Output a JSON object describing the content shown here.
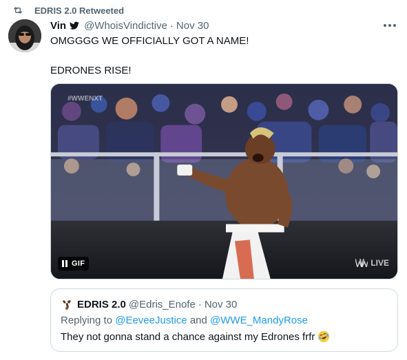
{
  "retweet": {
    "label": "EDRIS 2.0 Retweeted",
    "icon": "retweet-icon"
  },
  "tweet": {
    "author_name": "Vin",
    "author_handle": "@WhoisVindictive",
    "separator": "·",
    "date": "Nov 30",
    "verified_icon": "twitter-bird-icon",
    "lines": [
      "OMGGGG WE OFFICIALLY GOT A NAME!",
      "EDRONES RISE!"
    ],
    "media": {
      "badge_label": "GIF",
      "watermark_live": "LIVE",
      "watermark_tag": "#WWENXT"
    }
  },
  "quoted": {
    "author_name": "EDRIS 2.0",
    "author_handle": "@Edris_Enofe",
    "separator": "·",
    "date": "Nov 30",
    "replying_prefix": "Replying to ",
    "replying_to_1": "@EeveeJustice",
    "replying_and": " and ",
    "replying_to_2": "@WWE_MandyRose",
    "text": "They not gonna stand a chance against my Edrones frfr",
    "emoji_icon": "rolling-laughing-emoji-icon"
  },
  "colors": {
    "secondary_text": "#536471",
    "link": "#1d9bf0",
    "border": "#cfd9de"
  }
}
